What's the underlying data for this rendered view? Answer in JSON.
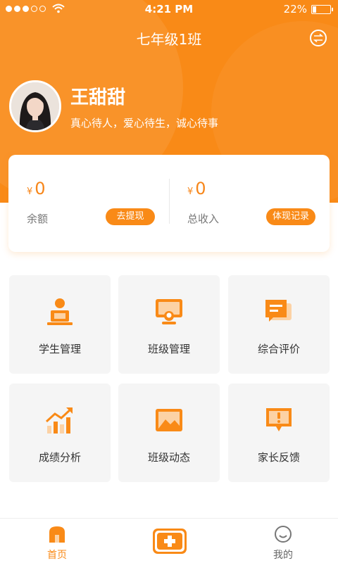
{
  "status_bar": {
    "time": "4:21 PM",
    "battery": "22%"
  },
  "header": {
    "title": "七年级1班"
  },
  "profile": {
    "name": "王甜甜",
    "motto": "真心待人，爱心待生，诚心待事"
  },
  "wallet": {
    "currency_symbol": "¥",
    "balance_amount": "0",
    "balance_label": "余额",
    "withdraw_button": "去提现",
    "income_amount": "0",
    "income_label": "总收入",
    "records_button": "体现记录"
  },
  "grid": {
    "items": [
      {
        "label": "学生管理",
        "icon": "student-icon"
      },
      {
        "label": "班级管理",
        "icon": "class-icon"
      },
      {
        "label": "综合评价",
        "icon": "evaluation-icon"
      },
      {
        "label": "成绩分析",
        "icon": "chart-icon"
      },
      {
        "label": "班级动态",
        "icon": "image-icon"
      },
      {
        "label": "家长反馈",
        "icon": "feedback-icon"
      }
    ]
  },
  "tabbar": {
    "home_label": "首页",
    "mine_label": "我的"
  },
  "colors": {
    "accent": "#f98a17",
    "tile_bg": "#f5f5f5",
    "text": "#333333"
  }
}
